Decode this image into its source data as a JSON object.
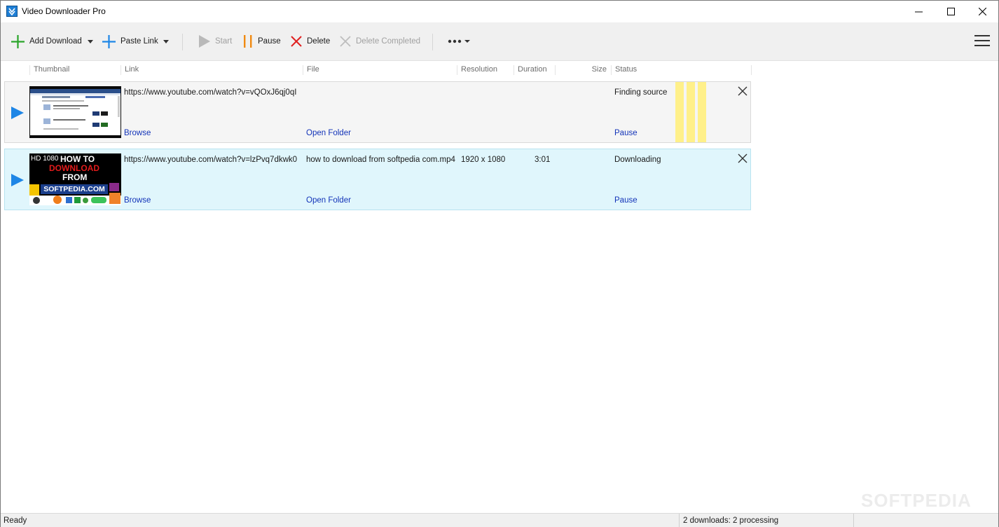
{
  "window": {
    "title": "Video Downloader Pro"
  },
  "toolbar": {
    "add_download": "Add Download",
    "paste_link": "Paste Link",
    "start": "Start",
    "pause": "Pause",
    "delete": "Delete",
    "delete_completed": "Delete Completed"
  },
  "columns": [
    "Thumbnail",
    "Link",
    "File",
    "Resolution",
    "Duration",
    "Size",
    "Status"
  ],
  "downloads": [
    {
      "link": "https://www.youtube.com/watch?v=vQOxJ6qj0qI",
      "file": "",
      "resolution": "",
      "duration": "",
      "size": "",
      "status": "Finding source",
      "browse": "Browse",
      "open_folder": "Open Folder",
      "pause": "Pause"
    },
    {
      "link": "https://www.youtube.com/watch?v=lzPvq7dkwk0",
      "file": "how to download from softpedia com.mp4",
      "resolution": "1920 x 1080",
      "duration": "3:01",
      "size": "",
      "status": "Downloading",
      "browse": "Browse",
      "open_folder": "Open Folder",
      "pause": "Pause",
      "thumb_text": {
        "hd": "HD 1080",
        "line1": "HOW TO",
        "line2": "DOWNLOAD",
        "line3": "FROM",
        "line4": "SOFTPEDIA.COM"
      }
    }
  ],
  "statusbar": {
    "left": "Ready",
    "center": "2 downloads: 2 processing"
  },
  "watermark": "SOFTPEDIA",
  "colors": {
    "accent_blue": "#1e86e6",
    "row_selected": "#e0f6fc",
    "link_blue": "#1233b8",
    "progress_yellow": "#fff08a"
  },
  "icons": {
    "add": "plus-icon",
    "paste": "plus-icon",
    "start": "play-icon",
    "pause": "pause-icon",
    "delete": "x-icon",
    "more": "ellipsis-icon",
    "menu": "hamburger-icon"
  }
}
